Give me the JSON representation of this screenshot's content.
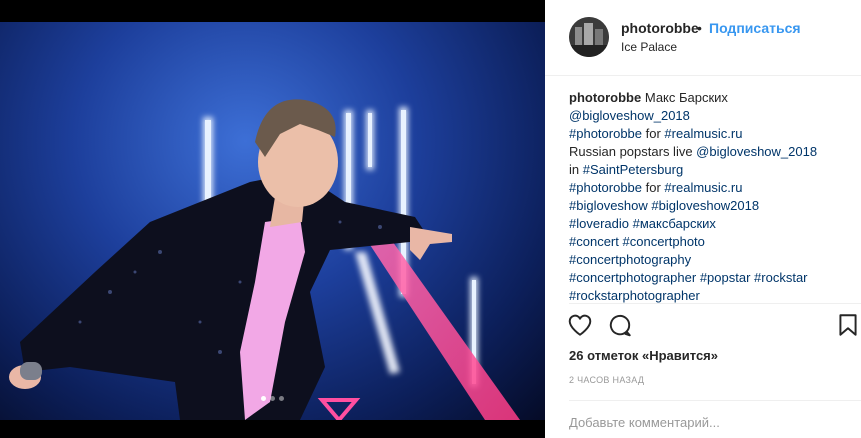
{
  "post": {
    "username": "photorobbe",
    "separator": "•",
    "follow_label": "Подписаться",
    "location": "Ice Palace"
  },
  "caption": {
    "username": "photorobbe",
    "lines": [
      [
        {
          "t": "text",
          "v": "Макс Барских"
        }
      ],
      [
        {
          "t": "tag",
          "v": "@bigloveshow_2018"
        }
      ],
      [
        {
          "t": "tag",
          "v": "#photorobbe"
        },
        {
          "t": "text",
          "v": " for "
        },
        {
          "t": "tag",
          "v": "#realmusic.ru"
        }
      ],
      [
        {
          "t": "text",
          "v": "Russian popstars live "
        },
        {
          "t": "tag",
          "v": "@bigloveshow_2018"
        }
      ],
      [
        {
          "t": "text",
          "v": "in "
        },
        {
          "t": "tag",
          "v": "#SaintPetersburg"
        }
      ],
      [
        {
          "t": "tag",
          "v": "#photorobbe"
        },
        {
          "t": "text",
          "v": " for "
        },
        {
          "t": "tag",
          "v": "#realmusic.ru"
        }
      ],
      [
        {
          "t": "tag",
          "v": "#bigloveshow"
        },
        {
          "t": "text",
          "v": " "
        },
        {
          "t": "tag",
          "v": "#bigloveshow2018"
        }
      ],
      [
        {
          "t": "tag",
          "v": "#loveradio"
        },
        {
          "t": "text",
          "v": " "
        },
        {
          "t": "tag",
          "v": "#максбарских"
        }
      ],
      [
        {
          "t": "tag",
          "v": "#concert"
        },
        {
          "t": "text",
          "v": " "
        },
        {
          "t": "tag",
          "v": "#concertphoto"
        }
      ],
      [
        {
          "t": "tag",
          "v": "#concertphotography"
        }
      ],
      [
        {
          "t": "tag",
          "v": "#concertphotographer"
        },
        {
          "t": "text",
          "v": " "
        },
        {
          "t": "tag",
          "v": "#popstar"
        },
        {
          "t": "text",
          "v": " "
        },
        {
          "t": "tag",
          "v": "#rockstar"
        }
      ],
      [
        {
          "t": "tag",
          "v": "#rockstarphotographer"
        }
      ]
    ]
  },
  "actions": {
    "icons": [
      "heart-icon",
      "comment-icon",
      "bookmark-icon"
    ]
  },
  "likes_text": "26 отметок «Нравится»",
  "time_text": "2 часов назад",
  "comment_placeholder": "Добавьте комментарий...",
  "photo": {
    "carousel_count": 3,
    "carousel_active": 0
  },
  "colors": {
    "link": "#003569",
    "follow": "#3897f0",
    "text": "#262626",
    "muted": "#999999"
  }
}
